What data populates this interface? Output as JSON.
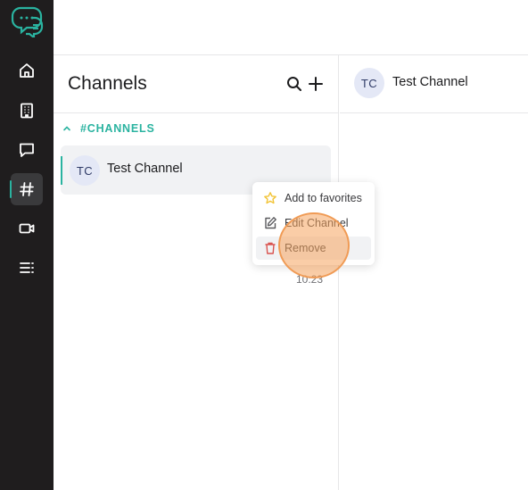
{
  "sidebar": {
    "logo_icon": "chat-bubbles-logo",
    "items": [
      {
        "name": "home",
        "icon": "home-icon",
        "active": false
      },
      {
        "name": "buildings",
        "icon": "building-icon",
        "active": false
      },
      {
        "name": "messages",
        "icon": "message-icon",
        "active": false
      },
      {
        "name": "channels",
        "icon": "hash-icon",
        "active": true
      },
      {
        "name": "video",
        "icon": "video-icon",
        "active": false
      },
      {
        "name": "list",
        "icon": "list-icon",
        "active": false
      }
    ]
  },
  "panel": {
    "title": "Channels",
    "search_icon": "search-icon",
    "add_icon": "plus-icon",
    "section_label": "#CHANNELS",
    "channels": [
      {
        "initials": "TC",
        "name": "Test Channel",
        "time": "10:23"
      }
    ]
  },
  "chat": {
    "initials": "TC",
    "name": "Test Channel"
  },
  "context_menu": {
    "items": [
      {
        "label": "Add to favorites",
        "icon": "star-icon"
      },
      {
        "label": "Edit Channel",
        "icon": "edit-icon"
      },
      {
        "label": "Remove",
        "icon": "trash-icon"
      }
    ]
  },
  "colors": {
    "accent": "#2ab3a0",
    "sidebar_bg": "#1f1d1e",
    "danger": "#d9534f",
    "star": "#f2c438",
    "highlight": "#f09b55"
  }
}
